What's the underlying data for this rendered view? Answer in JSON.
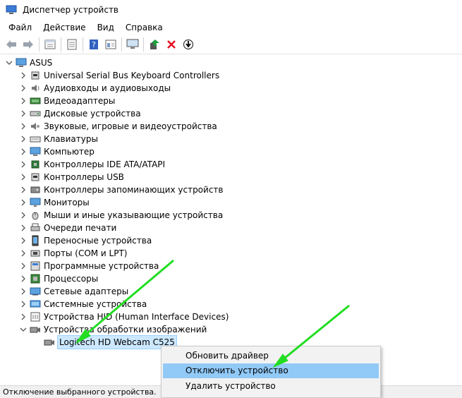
{
  "window": {
    "title": "Диспетчер устройств"
  },
  "menu": [
    "Файл",
    "Действие",
    "Вид",
    "Справка"
  ],
  "toolbar": {
    "icons": [
      "back-arrow-icon",
      "forward-arrow-icon",
      "properties-icon",
      "refresh-icon",
      "help-icon",
      "view-icon",
      "monitor-icon",
      "update-driver-icon",
      "remove-icon",
      "disable-icon"
    ],
    "colors": {
      "remove": "#e81123",
      "update": "#1e9e3e"
    }
  },
  "tree": {
    "root": "ASUS",
    "categories": [
      "Universal Serial Bus Keyboard Controllers",
      "Аудиовходы и аудиовыходы",
      "Видеоадаптеры",
      "Дисковые устройства",
      "Звуковые, игровые и видеоустройства",
      "Клавиатуры",
      "Компьютер",
      "Контроллеры IDE ATA/ATAPI",
      "Контроллеры USB",
      "Контроллеры запоминающих устройств",
      "Мониторы",
      "Мыши и иные указывающие устройства",
      "Очереди печати",
      "Переносные устройства",
      "Порты (COM и LPT)",
      "Программные устройства",
      "Процессоры",
      "Сетевые адаптеры",
      "Системные устройства",
      "Устройства HID (Human Interface Devices)",
      "Устройства обработки изображений"
    ],
    "child": "Logitech HD Webcam C525"
  },
  "context_menu": {
    "items": [
      "Обновить драйвер",
      "Отключить устройство",
      "Удалить устройство"
    ],
    "highlighted_index": 1
  },
  "status": {
    "text": "Отключение выбранного устройства."
  },
  "annotation": {
    "arrow_color": "#22dd22"
  }
}
